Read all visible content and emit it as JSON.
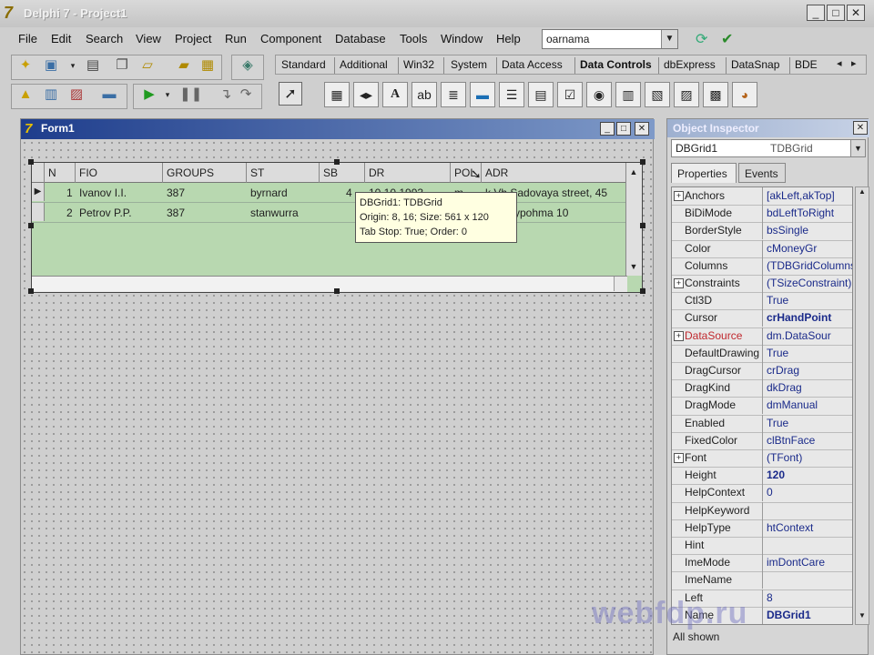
{
  "window": {
    "title": "Delphi 7 - Project1"
  },
  "menu": [
    "File",
    "Edit",
    "Search",
    "View",
    "Project",
    "Run",
    "Component",
    "Database",
    "Tools",
    "Window",
    "Help"
  ],
  "desktop_combo": {
    "value": "oarnama"
  },
  "palette": {
    "tabs": [
      "Standard",
      "Additional",
      "Win32",
      "System",
      "Data Access",
      "Data Controls",
      "dbExpress",
      "DataSnap",
      "BDE"
    ],
    "active_tab": "Data Controls"
  },
  "form": {
    "title": "Form1",
    "grid": {
      "columns": [
        "N",
        "FIO",
        "GROUPS",
        "ST",
        "SB",
        "DR",
        "POL",
        "ADR"
      ],
      "rows": [
        {
          "n": "1",
          "fio": "Ivanov I.I.",
          "groups": "387",
          "st": "byrnard",
          "sb": "4",
          "dr": "10.10.1993",
          "pol": "m",
          "adr": "k.Vh Sadovaya street, 45"
        },
        {
          "n": "2",
          "fio": "Petrov P.P.",
          "groups": "387",
          "st": "stanwurra",
          "sb": "",
          "dr": "",
          "pol": "",
          "adr": "ypohma 10"
        }
      ]
    },
    "hint": {
      "line1": "DBGrid1: TDBGrid",
      "line2": "Origin: 8, 16; Size: 561 x 120",
      "line3": "Tab Stop: True; Order: 0"
    }
  },
  "inspector": {
    "title": "Object Inspector",
    "selected": "DBGrid1",
    "selected_type": "TDBGrid",
    "tabs": [
      "Properties",
      "Events"
    ],
    "properties": [
      {
        "name": "Anchors",
        "value": "[akLeft,akTop]",
        "expandable": true
      },
      {
        "name": "BiDiMode",
        "value": "bdLeftToRight",
        "expandable": false
      },
      {
        "name": "BorderStyle",
        "value": "bsSingle",
        "expandable": false
      },
      {
        "name": "Color",
        "value": "cMoneyGr",
        "expandable": false
      },
      {
        "name": "Columns",
        "value": "(TDBGridColumns)",
        "expandable": false
      },
      {
        "name": "Constraints",
        "value": "(TSizeConstraint)",
        "expandable": true
      },
      {
        "name": "Ctl3D",
        "value": "True",
        "expandable": false
      },
      {
        "name": "Cursor",
        "value": "crHandPoint",
        "expandable": false
      },
      {
        "name": "DataSource",
        "value": "dm.DataSour",
        "expandable": true
      },
      {
        "name": "DefaultDrawing",
        "value": "True",
        "expandable": false
      },
      {
        "name": "DragCursor",
        "value": "crDrag",
        "expandable": false
      },
      {
        "name": "DragKind",
        "value": "dkDrag",
        "expandable": false
      },
      {
        "name": "DragMode",
        "value": "dmManual",
        "expandable": false
      },
      {
        "name": "Enabled",
        "value": "True",
        "expandable": false
      },
      {
        "name": "FixedColor",
        "value": "clBtnFace",
        "expandable": false
      },
      {
        "name": "Font",
        "value": "(TFont)",
        "expandable": true
      },
      {
        "name": "Height",
        "value": "120",
        "expandable": false
      },
      {
        "name": "HelpContext",
        "value": "0",
        "expandable": false
      },
      {
        "name": "HelpKeyword",
        "value": "",
        "expandable": false
      },
      {
        "name": "HelpType",
        "value": "htContext",
        "expandable": false
      },
      {
        "name": "Hint",
        "value": "",
        "expandable": false
      },
      {
        "name": "ImeMode",
        "value": "imDontCare",
        "expandable": false
      },
      {
        "name": "ImeName",
        "value": "",
        "expandable": false
      },
      {
        "name": "Left",
        "value": "8",
        "expandable": false
      },
      {
        "name": "Name",
        "value": "DBGrid1",
        "expandable": false
      }
    ],
    "status": "All shown"
  },
  "watermark": "webfdp.ru",
  "colors": {
    "grid_bg": "#b8d8b0",
    "form_caption": "#1e3d8c",
    "hint_bg": "#ffffe1",
    "datasource_red": "#c0282e"
  },
  "icons": {
    "title_logo": "delphi-logo",
    "close": "close-icon",
    "minimize": "minimize-icon",
    "maximize": "maximize-icon"
  }
}
